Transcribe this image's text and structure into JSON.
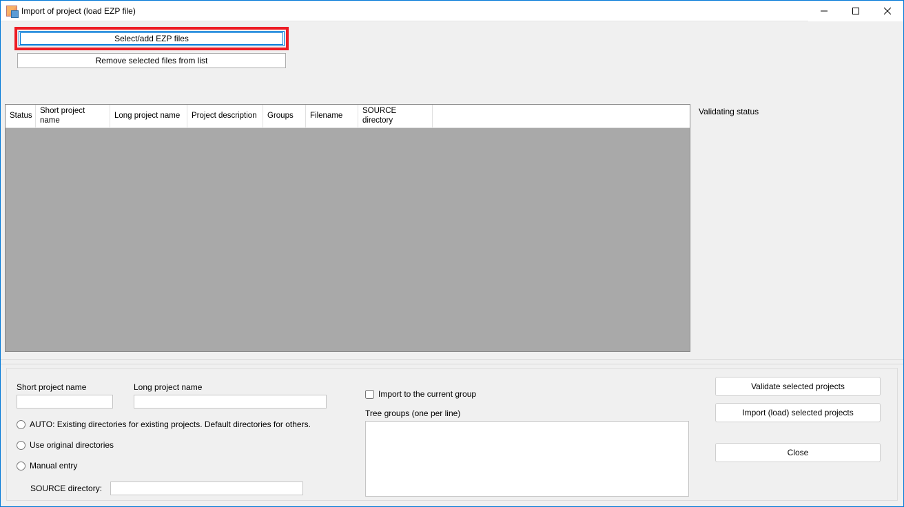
{
  "window": {
    "title": "Import of project (load EZP file)"
  },
  "topButtons": {
    "selectAdd": "Select/add EZP files",
    "removeSelected": "Remove selected files from list"
  },
  "grid": {
    "columns": {
      "status": "Status",
      "shortName": "Short project name",
      "longName": "Long project name",
      "description": "Project description",
      "groups": "Groups",
      "filename": "Filename",
      "sourceDir": "SOURCE directory"
    }
  },
  "rightPanel": {
    "validatingStatus": "Validating status"
  },
  "form": {
    "shortProjectNameLabel": "Short project name",
    "longProjectNameLabel": "Long project name",
    "shortProjectNameValue": "",
    "longProjectNameValue": "",
    "radioAuto": "AUTO: Existing directories for existing projects. Default directories for others.",
    "radioOriginal": "Use original directories",
    "radioManual": "Manual entry",
    "sourceDirLabel": "SOURCE directory:",
    "sourceDirValue": "",
    "importCurrentGroup": "Import to the current group",
    "treeGroupsLabel": "Tree groups (one per line)",
    "treeGroupsValue": ""
  },
  "actions": {
    "validate": "Validate selected projects",
    "import": "Import (load) selected projects",
    "close": "Close"
  }
}
